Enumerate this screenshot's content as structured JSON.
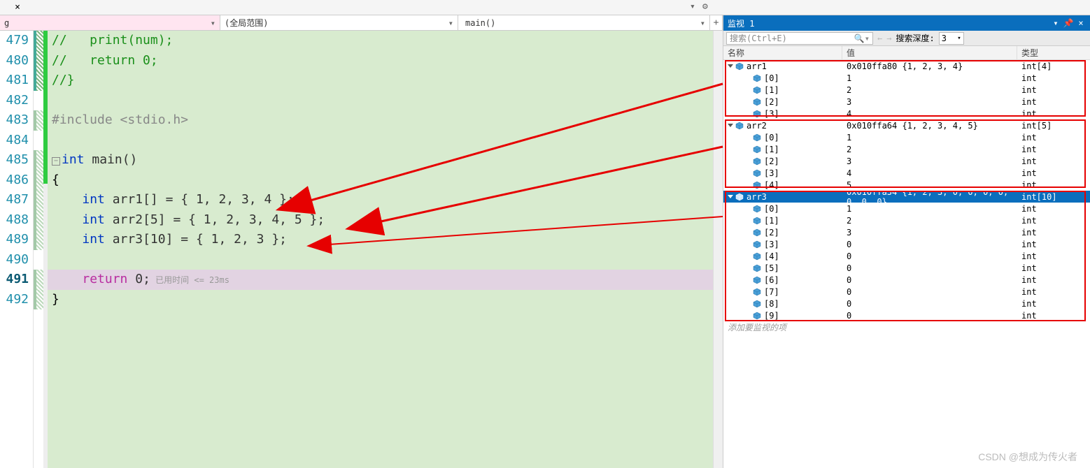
{
  "tabs": {
    "close_label": "×"
  },
  "dropdowns": {
    "d1": "g",
    "d2": "(全局范围)",
    "d3": "main()"
  },
  "gutter_start": 479,
  "code_lines": [
    {
      "type": "comment",
      "text": "//   print(num);"
    },
    {
      "type": "comment",
      "text": "//   return 0;"
    },
    {
      "type": "comment",
      "text": "//}"
    },
    {
      "type": "blank",
      "text": ""
    },
    {
      "type": "pre",
      "text": "#include <stdio.h>"
    },
    {
      "type": "blank",
      "text": ""
    },
    {
      "type": "func_sig",
      "tokens": [
        {
          "t": "int ",
          "c": "kw"
        },
        {
          "t": "main",
          "c": "id"
        },
        {
          "t": "()",
          "c": "punc"
        }
      ],
      "has_box": true
    },
    {
      "type": "brace",
      "text": "{"
    },
    {
      "type": "decl",
      "tokens": [
        {
          "t": "    ",
          "c": ""
        },
        {
          "t": "int ",
          "c": "kw"
        },
        {
          "t": "arr1",
          "c": "id"
        },
        {
          "t": "[] = { ",
          "c": "punc"
        },
        {
          "t": "1, 2, 3, 4",
          "c": "num"
        },
        {
          "t": " };",
          "c": "punc"
        }
      ]
    },
    {
      "type": "decl",
      "tokens": [
        {
          "t": "    ",
          "c": ""
        },
        {
          "t": "int ",
          "c": "kw"
        },
        {
          "t": "arr2",
          "c": "id"
        },
        {
          "t": "[",
          "c": "punc"
        },
        {
          "t": "5",
          "c": "num"
        },
        {
          "t": "] = { ",
          "c": "punc"
        },
        {
          "t": "1, 2, 3, 4, 5",
          "c": "num"
        },
        {
          "t": " };",
          "c": "punc"
        }
      ]
    },
    {
      "type": "decl",
      "tokens": [
        {
          "t": "    ",
          "c": ""
        },
        {
          "t": "int ",
          "c": "kw"
        },
        {
          "t": "arr3",
          "c": "id"
        },
        {
          "t": "[",
          "c": "punc"
        },
        {
          "t": "10",
          "c": "num"
        },
        {
          "t": "] = { ",
          "c": "punc"
        },
        {
          "t": "1, 2, 3",
          "c": "num"
        },
        {
          "t": " };",
          "c": "punc"
        }
      ]
    },
    {
      "type": "blank",
      "text": ""
    },
    {
      "type": "return",
      "tokens": [
        {
          "t": "    ",
          "c": ""
        },
        {
          "t": "return ",
          "c": "ret"
        },
        {
          "t": "0",
          "c": "num"
        },
        {
          "t": ";",
          "c": "punc"
        }
      ],
      "hint": " 已用时间 <= 23ms",
      "current": true
    },
    {
      "type": "brace",
      "text": "}"
    }
  ],
  "watch": {
    "title": "监视 1",
    "search_placeholder": "搜索(Ctrl+E)",
    "depth_label": "搜索深度:",
    "depth_value": "3",
    "headers": {
      "name": "名称",
      "value": "值",
      "type": "类型"
    },
    "add_item": "添加要监视的项",
    "groups": [
      {
        "name": "arr1",
        "value": "0x010ffa80 {1, 2, 3, 4}",
        "type": "int[4]",
        "expanded": true,
        "children": [
          {
            "name": "[0]",
            "value": "1",
            "type": "int"
          },
          {
            "name": "[1]",
            "value": "2",
            "type": "int"
          },
          {
            "name": "[2]",
            "value": "3",
            "type": "int"
          },
          {
            "name": "[3]",
            "value": "4",
            "type": "int"
          }
        ]
      },
      {
        "name": "arr2",
        "value": "0x010ffa64 {1, 2, 3, 4, 5}",
        "type": "int[5]",
        "expanded": true,
        "children": [
          {
            "name": "[0]",
            "value": "1",
            "type": "int"
          },
          {
            "name": "[1]",
            "value": "2",
            "type": "int"
          },
          {
            "name": "[2]",
            "value": "3",
            "type": "int"
          },
          {
            "name": "[3]",
            "value": "4",
            "type": "int"
          },
          {
            "name": "[4]",
            "value": "5",
            "type": "int"
          }
        ]
      },
      {
        "name": "arr3",
        "value": "0x010ffa34 {1, 2, 3, 0, 0, 0, 0, 0, 0, 0}",
        "type": "int[10]",
        "expanded": true,
        "selected": true,
        "children": [
          {
            "name": "[0]",
            "value": "1",
            "type": "int"
          },
          {
            "name": "[1]",
            "value": "2",
            "type": "int"
          },
          {
            "name": "[2]",
            "value": "3",
            "type": "int"
          },
          {
            "name": "[3]",
            "value": "0",
            "type": "int"
          },
          {
            "name": "[4]",
            "value": "0",
            "type": "int"
          },
          {
            "name": "[5]",
            "value": "0",
            "type": "int"
          },
          {
            "name": "[6]",
            "value": "0",
            "type": "int"
          },
          {
            "name": "[7]",
            "value": "0",
            "type": "int"
          },
          {
            "name": "[8]",
            "value": "0",
            "type": "int"
          },
          {
            "name": "[9]",
            "value": "0",
            "type": "int"
          }
        ]
      }
    ]
  },
  "watermark": "CSDN @想成为传火者"
}
